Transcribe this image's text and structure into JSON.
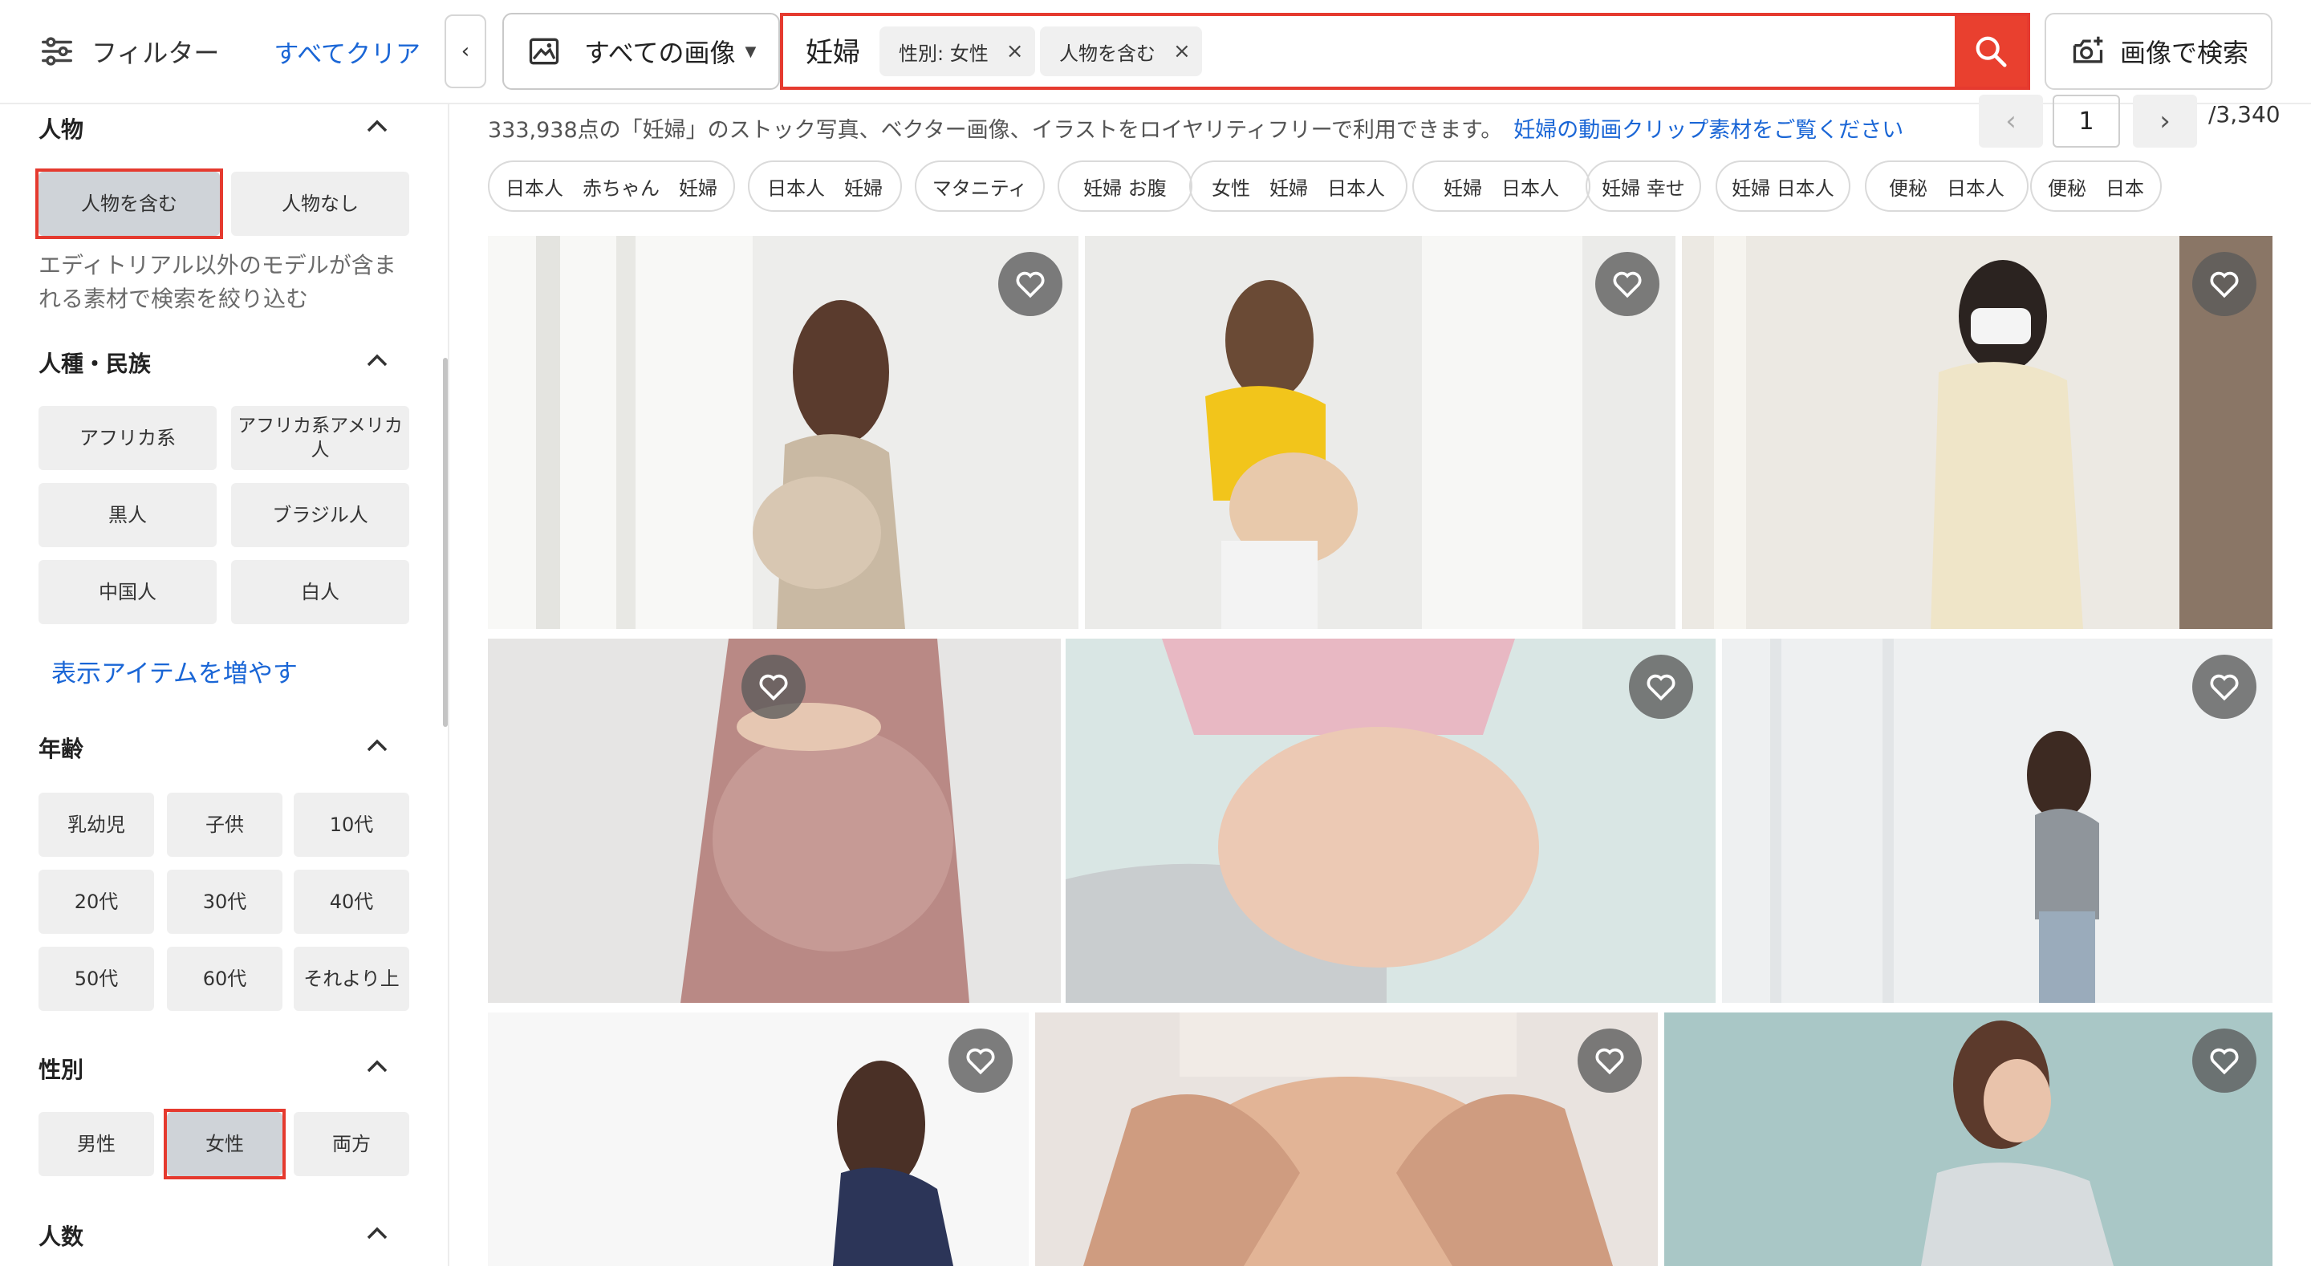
{
  "header": {
    "filter_label": "フィルター",
    "clear_all": "すべてクリア",
    "collapse": "‹",
    "type_select": "すべての画像",
    "query": "妊婦",
    "chips": [
      {
        "label": "性別: 女性",
        "close": "×"
      },
      {
        "label": "人物を含む",
        "close": "×"
      }
    ],
    "image_search": "画像で検索"
  },
  "sidebar": {
    "people": {
      "title": "人物",
      "options": [
        "人物を含む",
        "人物なし"
      ],
      "selected": "人物を含む",
      "helper": [
        "エディトリアル以外のモデルが含ま",
        "れる素材で検索を絞り込む"
      ]
    },
    "ethnicity": {
      "title": "人種・民族",
      "options": [
        "アフリカ系",
        "アフリカ系アメリカ人",
        "黒人",
        "ブラジル人",
        "中国人",
        "白人"
      ],
      "more": "表示アイテムを増やす"
    },
    "age": {
      "title": "年齢",
      "options": [
        "乳幼児",
        "子供",
        "10代",
        "20代",
        "30代",
        "40代",
        "50代",
        "60代",
        "それより上"
      ]
    },
    "gender": {
      "title": "性別",
      "options": [
        "男性",
        "女性",
        "両方"
      ],
      "selected": "女性"
    },
    "count": {
      "title": "人数"
    }
  },
  "results": {
    "count_text": "333,938点の「妊婦」のストック写真、ベクター画像、イラストをロイヤリティフリーで利用できます。",
    "video_link": "妊婦の動画クリップ素材をご覧ください",
    "pagination": {
      "prev": "‹",
      "current": "1",
      "next": "›",
      "total": "/3,340"
    },
    "related_tags": [
      "日本人　赤ちゃん　妊婦",
      "日本人　妊婦",
      "マタニティ",
      "妊婦 お腹",
      "女性　妊婦　日本人",
      "妊婦　日本人",
      "妊婦 幸せ",
      "妊婦 日本人",
      "便秘　日本人",
      "便秘　日本"
    ]
  },
  "colors": {
    "accent_red": "#e53a2f",
    "link_blue": "#1a66d6",
    "selected_button": "#cfd3d8"
  },
  "icons": [
    "filter-sliders-icon",
    "chevron-left-icon",
    "image-icon",
    "caret-down-icon",
    "close-icon",
    "search-icon",
    "camera-plus-icon",
    "chevron-up-icon",
    "heart-icon"
  ]
}
